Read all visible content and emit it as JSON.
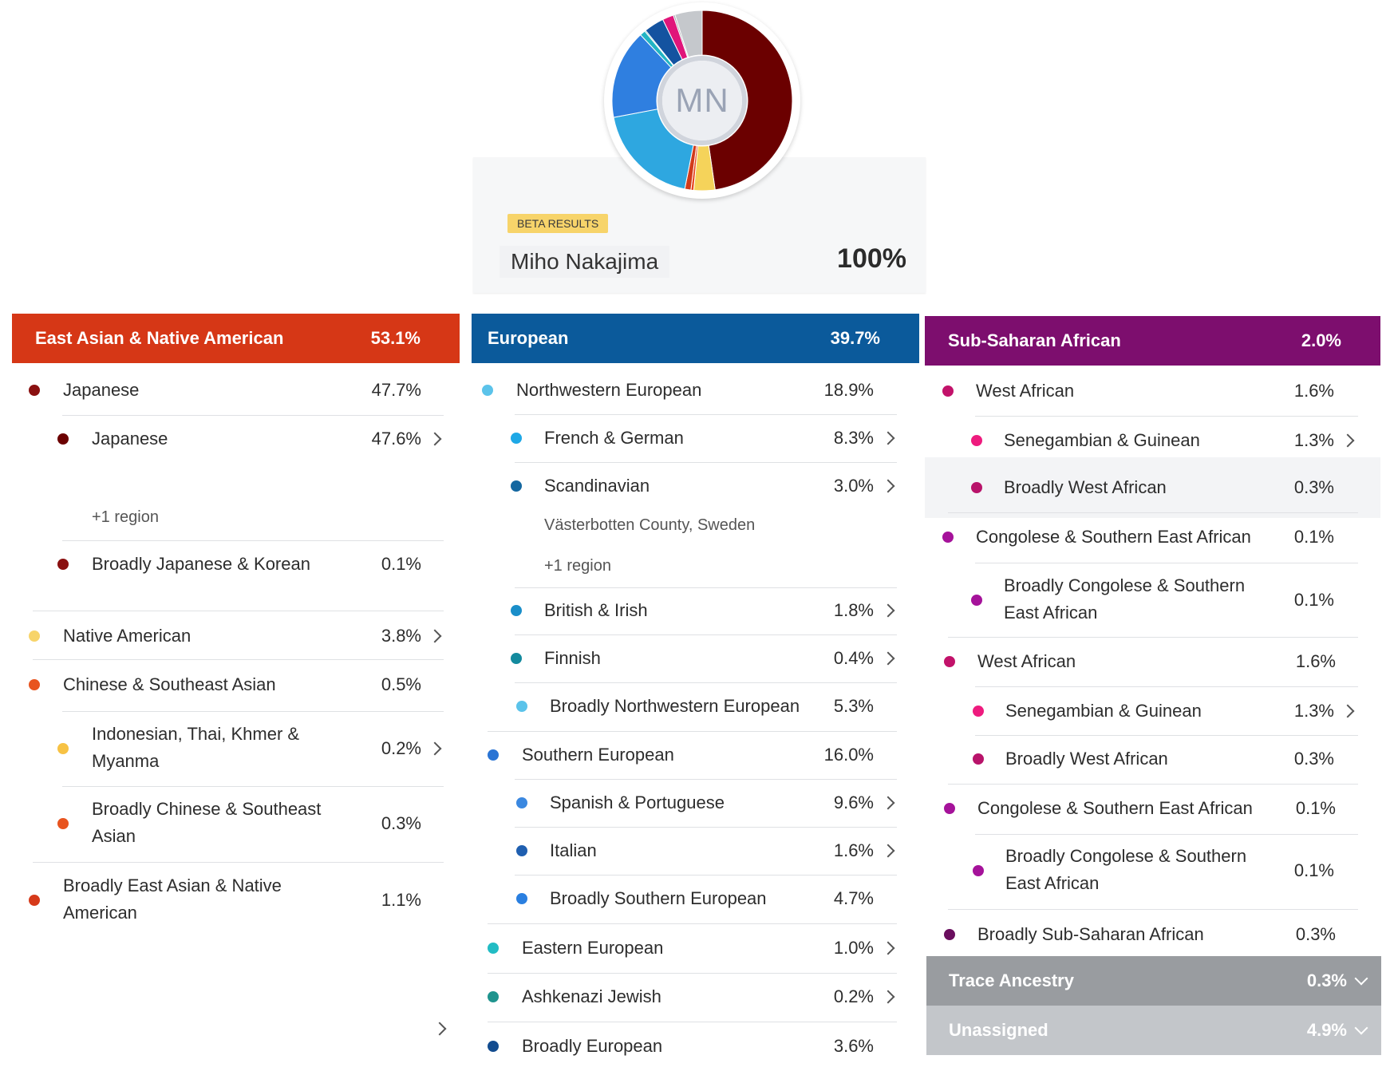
{
  "header": {
    "initials": "MN",
    "badge": "BETA RESULTS",
    "name": "Miho Nakajima",
    "total": "100%"
  },
  "donut_segments": [
    {
      "name": "Japanese",
      "value": 47.7,
      "color": "#6b0000"
    },
    {
      "name": "Native American",
      "value": 3.8,
      "color": "#f5d35a"
    },
    {
      "name": "Chinese & Southeast Asian",
      "value": 0.5,
      "color": "#e8451f"
    },
    {
      "name": "Broadly East Asian & Native American",
      "value": 1.1,
      "color": "#d13b1a"
    },
    {
      "name": "Northwestern European",
      "value": 18.9,
      "color": "#2ea7e0"
    },
    {
      "name": "Southern European",
      "value": 16.0,
      "color": "#2f7fe0"
    },
    {
      "name": "Eastern European",
      "value": 1.0,
      "color": "#22b4c4"
    },
    {
      "name": "Ashkenazi Jewish",
      "value": 0.2,
      "color": "#1c8f8a"
    },
    {
      "name": "Broadly European",
      "value": 3.6,
      "color": "#1453a0"
    },
    {
      "name": "Sub-Saharan African",
      "value": 2.0,
      "color": "#e0157a"
    },
    {
      "name": "Trace Ancestry",
      "value": 0.3,
      "color": "#a0a4aa"
    },
    {
      "name": "Unassigned",
      "value": 4.9,
      "color": "#c5c8cc"
    }
  ],
  "col1": {
    "title": "East Asian & Native American",
    "pct": "53.1%",
    "color": "#d63716",
    "rows": [
      {
        "label": "Japanese",
        "pct": "47.7%",
        "dot": "#8a1010"
      },
      {
        "label": "Japanese",
        "pct": "47.6%",
        "dot": "#6b0000"
      },
      {
        "label": "+1 region"
      },
      {
        "label": "Broadly Japanese & Korean",
        "pct": "0.1%",
        "dot": "#8a1010"
      },
      {
        "label": "Native American",
        "pct": "3.8%",
        "dot": "#f7d46a"
      },
      {
        "label": "Chinese & Southeast Asian",
        "pct": "0.5%",
        "dot": "#e8541f"
      },
      {
        "label": "Indonesian, Thai, Khmer &",
        "label2": "Myanma",
        "pct": "0.2%",
        "dot": "#f7c244"
      },
      {
        "label": "Broadly Chinese & Southeast",
        "label2": "Asian",
        "pct": "0.3%",
        "dot": "#e8541f"
      },
      {
        "label": "Broadly East Asian & Native",
        "label2": "American",
        "pct": "1.1%",
        "dot": "#d63a1a"
      }
    ]
  },
  "col2": {
    "title": "European",
    "pct": "39.7%",
    "color": "#0b5a9b",
    "rows": [
      {
        "label": "Northwestern European",
        "pct": "18.9%",
        "dot": "#5bc3ea"
      },
      {
        "label": "French & German",
        "pct": "8.3%",
        "dot": "#1ea8e6"
      },
      {
        "label": "Scandinavian",
        "pct": "3.0%",
        "dot": "#1467a0"
      },
      {
        "label": "Västerbotten County, Sweden"
      },
      {
        "label": "+1 region"
      },
      {
        "label": "British & Irish",
        "pct": "1.8%",
        "dot": "#1a8ec9"
      },
      {
        "label": "Finnish",
        "pct": "0.4%",
        "dot": "#138a9e"
      },
      {
        "label": "Broadly Northwestern European",
        "pct": "5.3%",
        "dot": "#5bc3ea"
      },
      {
        "label": "Southern European",
        "pct": "16.0%",
        "dot": "#2a74d4"
      },
      {
        "label": "Spanish & Portuguese",
        "pct": "9.6%",
        "dot": "#3a88e0"
      },
      {
        "label": "Italian",
        "pct": "1.6%",
        "dot": "#1f5fb0"
      },
      {
        "label": "Broadly Southern European",
        "pct": "4.7%",
        "dot": "#2a7fe0"
      },
      {
        "label": "Eastern European",
        "pct": "1.0%",
        "dot": "#22bcc4"
      },
      {
        "label": "Ashkenazi Jewish",
        "pct": "0.2%",
        "dot": "#1f948e"
      },
      {
        "label": "Broadly European",
        "pct": "3.6%",
        "dot": "#124c8f"
      }
    ]
  },
  "col3": {
    "title": "Sub-Saharan African",
    "pct": "2.0%",
    "color": "#7d0e6e",
    "rows": [
      {
        "label": "West African",
        "pct": "1.6%",
        "dot": "#c2126a"
      },
      {
        "label": "Senegambian & Guinean",
        "pct": "1.3%",
        "dot": "#ee1b7e"
      },
      {
        "label": "Broadly West African",
        "pct": "0.3%",
        "dot": "#b8136a"
      },
      {
        "label": "Congolese & Southern East African",
        "pct": "0.1%",
        "dot": "#a5129a"
      },
      {
        "label": "Broadly Congolese & Southern",
        "label2": "East African",
        "pct": "0.1%",
        "dot": "#a5129a"
      },
      {
        "label": "West African",
        "pct": "1.6%",
        "dot": "#c2126a"
      },
      {
        "label": "Senegambian & Guinean",
        "pct": "1.3%",
        "dot": "#ee1b7e"
      },
      {
        "label": "Broadly West African",
        "pct": "0.3%",
        "dot": "#b8136a"
      },
      {
        "label": "Congolese & Southern East African",
        "pct": "0.1%",
        "dot": "#a5129a"
      },
      {
        "label": "Broadly Congolese & Southern",
        "label2": "East African",
        "pct": "0.1%",
        "dot": "#a5129a"
      },
      {
        "label": "Broadly Sub-Saharan African",
        "pct": "0.3%",
        "dot": "#6a0e5e"
      }
    ],
    "trace": {
      "label": "Trace Ancestry",
      "pct": "0.3%"
    },
    "unassigned": {
      "label": "Unassigned",
      "pct": "4.9%"
    }
  }
}
